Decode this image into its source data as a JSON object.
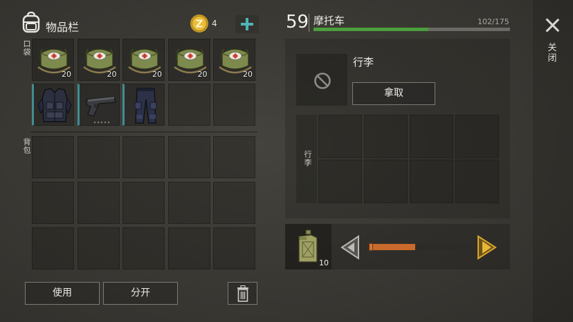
{
  "inventory": {
    "title": "物品栏",
    "coins": "4",
    "coin_letter": "Z",
    "pocket_label": "口袋",
    "backpack_label": "背包",
    "pockets": [
      {
        "item": "first-aid-bag",
        "qty": "20"
      },
      {
        "item": "first-aid-bag",
        "qty": "20"
      },
      {
        "item": "first-aid-bag",
        "qty": "20"
      },
      {
        "item": "first-aid-bag",
        "qty": "20"
      },
      {
        "item": "first-aid-bag",
        "qty": "20"
      },
      {
        "item": "tactical-vest",
        "qty": "",
        "equipped": true
      },
      {
        "item": "pistol",
        "qty": "",
        "equipped": true
      },
      {
        "item": "tactical-pants",
        "qty": "",
        "equipped": true
      },
      {
        "item": "",
        "qty": ""
      },
      {
        "item": "",
        "qty": ""
      }
    ],
    "backpack_slots": 15,
    "use_label": "使用",
    "split_label": "分开",
    "trash_icon": "trash-icon"
  },
  "vehicle": {
    "level": "59",
    "name": "摩托车",
    "capacity": "102/175",
    "capacity_fraction": 0.583,
    "luggage_title": "行李",
    "take_label": "拿取",
    "luggage_side_label": "行李",
    "luggage_slots": 8,
    "fuel": {
      "item": "jerry-can",
      "qty": "10",
      "level": 0.45
    }
  },
  "close_label": "关闭",
  "colors": {
    "accent": "#4fb3b6",
    "capacity_bar": "#4aa03c",
    "fuel_bar": "#c96a2c",
    "arrow_gold": "#d8a52c",
    "equipped_marker": "#3f8d93"
  }
}
